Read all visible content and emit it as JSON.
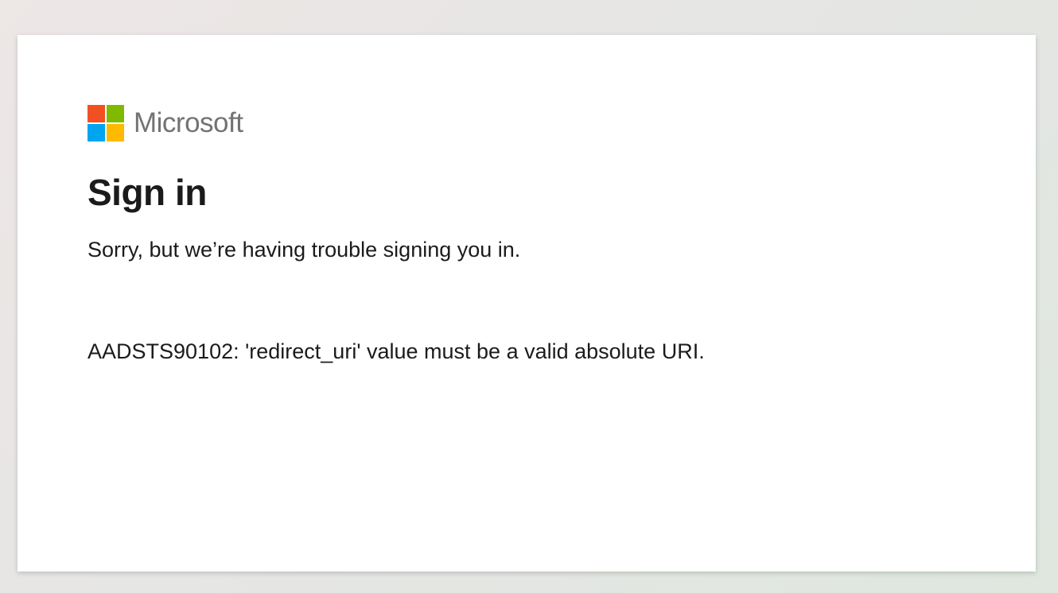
{
  "brand": {
    "name": "Microsoft",
    "logo_icon": "microsoft-logo-icon",
    "logo_colors": [
      "#f25022",
      "#7fba00",
      "#00a4ef",
      "#ffb900"
    ]
  },
  "page": {
    "title": "Sign in",
    "message": "Sorry, but we’re having trouble signing you in.",
    "error_detail": "AADSTS90102: 'redirect_uri' value must be a valid absolute URI."
  }
}
